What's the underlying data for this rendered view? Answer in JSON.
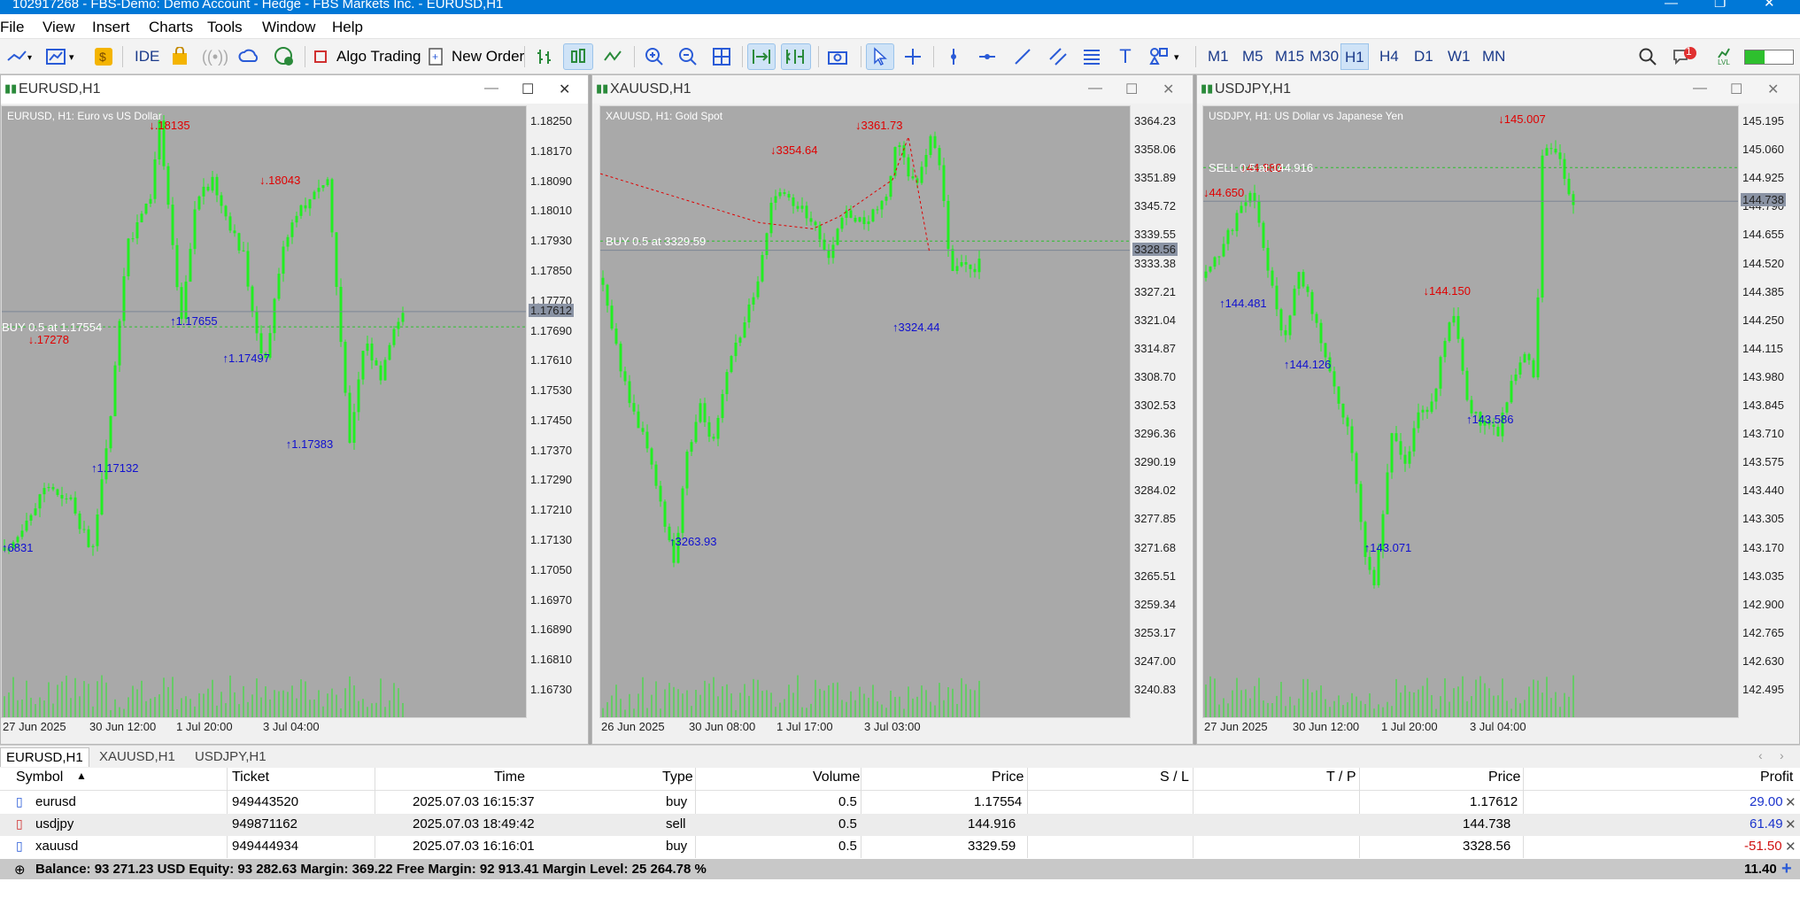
{
  "window": {
    "title": "102917268 - FBS-Demo: Demo Account - Hedge - FBS Markets Inc. - EURUSD,H1"
  },
  "menu": [
    "File",
    "View",
    "Insert",
    "Charts",
    "Tools",
    "Window",
    "Help"
  ],
  "toolbar": {
    "ide": "IDE",
    "algo_trading": "Algo Trading",
    "new_order": "New Order",
    "notifications_count": "1",
    "lvl": "LVL"
  },
  "timeframes": [
    "M1",
    "M5",
    "M15",
    "M30",
    "H1",
    "H4",
    "D1",
    "W1",
    "MN"
  ],
  "active_timeframe": "H1",
  "charts": [
    {
      "id": "eurusd",
      "caption": "EURUSD,H1",
      "info": "EURUSD, H1:  Euro vs US Dollar",
      "price_ticks": [
        "1.18250",
        "1.18170",
        "1.18090",
        "1.18010",
        "1.17930",
        "1.17850",
        "1.17770",
        "1.17690",
        "1.17610",
        "1.17530",
        "1.17450",
        "1.17370",
        "1.17290",
        "1.17210",
        "1.17130",
        "1.17050",
        "1.16970",
        "1.16890",
        "1.16810",
        "1.16730"
      ],
      "current_price": "1.17612",
      "time_ticks": [
        "27 Jun 2025",
        "30 Jun 12:00",
        "1 Jul 20:00",
        "3 Jul 04:00"
      ],
      "trade_line": "BUY 0.5 at 1.17554",
      "labels_down": [
        ".18135",
        ".18043",
        ".17278"
      ],
      "labels_up": [
        "1.17655",
        "1.17497",
        "1.17132",
        "1.17383",
        "6831"
      ],
      "ylim": [
        1.1668,
        1.1833
      ],
      "chart_data": {
        "type": "candlestick",
        "series_color": "#22dd22"
      }
    },
    {
      "id": "xauusd",
      "caption": "XAUUSD,H1",
      "info": "XAUUSD, H1:  Gold Spot",
      "price_ticks": [
        "3364.23",
        "3358.06",
        "3351.89",
        "3345.72",
        "3339.55",
        "3333.38",
        "3327.21",
        "3321.04",
        "3314.87",
        "3308.70",
        "3302.53",
        "3296.36",
        "3290.19",
        "3284.02",
        "3277.85",
        "3271.68",
        "3265.51",
        "3259.34",
        "3253.17",
        "3247.00",
        "3240.83"
      ],
      "current_price": "3328.56",
      "time_ticks": [
        "26 Jun 2025",
        "30 Jun 08:00",
        "1 Jul 17:00",
        "3 Jul 03:00"
      ],
      "trade_line": "BUY 0.5 at 3329.59",
      "labels_down": [
        "3354.64",
        "3361.73"
      ],
      "labels_up": [
        "3263.93",
        "3324.44"
      ],
      "ylim": [
        3237,
        3368
      ]
    },
    {
      "id": "usdjpy",
      "caption": "USDJPY,H1",
      "info": "USDJPY, H1:  US Dollar vs Japanese Yen",
      "price_ticks": [
        "145.195",
        "145.060",
        "144.925",
        "144.790",
        "144.655",
        "144.520",
        "144.385",
        "144.250",
        "144.115",
        "143.980",
        "143.845",
        "143.710",
        "143.575",
        "143.440",
        "143.305",
        "143.170",
        "143.035",
        "142.900",
        "142.765",
        "142.630",
        "142.495"
      ],
      "current_price": "144.738",
      "time_ticks": [
        "27 Jun 2025",
        "30 Jun 12:00",
        "1 Jul 20:00",
        "3 Jul 04:00"
      ],
      "trade_line": "SELL 0.5 at 144.916",
      "labels_down": [
        "44.880",
        "44.650",
        "144.150",
        "145.007"
      ],
      "labels_up": [
        "144.481",
        "144.126",
        "143.071",
        "143.586"
      ],
      "ylim": [
        142.44,
        145.27
      ]
    }
  ],
  "bottom_tabs": [
    "EURUSD,H1",
    "XAUUSD,H1",
    "USDJPY,H1"
  ],
  "trade_table": {
    "headers": [
      "Symbol",
      "Ticket",
      "Time",
      "Type",
      "Volume",
      "Price",
      "S / L",
      "T / P",
      "Price",
      "Profit"
    ],
    "rows": [
      {
        "symbol": "eurusd",
        "ticket": "949443520",
        "time": "2025.07.03 16:15:37",
        "type": "buy",
        "volume": "0.5",
        "price": "1.17554",
        "sl": "",
        "tp": "",
        "cur": "1.17612",
        "profit": "29.00",
        "profit_color": "#1a33cc"
      },
      {
        "symbol": "usdjpy",
        "ticket": "949871162",
        "time": "2025.07.03 18:49:42",
        "type": "sell",
        "volume": "0.5",
        "price": "144.916",
        "sl": "",
        "tp": "",
        "cur": "144.738",
        "profit": "61.49",
        "profit_color": "#1a33cc"
      },
      {
        "symbol": "xauusd",
        "ticket": "949444934",
        "time": "2025.07.03 16:16:01",
        "type": "buy",
        "volume": "0.5",
        "price": "3329.59",
        "sl": "",
        "tp": "",
        "cur": "3328.56",
        "profit": "-51.50",
        "profit_color": "#d01010"
      }
    ],
    "summary": "Balance: 93 271.23 USD  Equity: 93 282.63  Margin: 369.22  Free Margin: 92 913.41  Margin Level: 25 264.78 %",
    "total_profit": "11.40"
  },
  "colors": {
    "bull": "#22ee22",
    "chart_bg": "#a9a9a9",
    "down_arrow": "#e00000",
    "up_arrow": "#1010d0",
    "accent": "#0078d7"
  }
}
